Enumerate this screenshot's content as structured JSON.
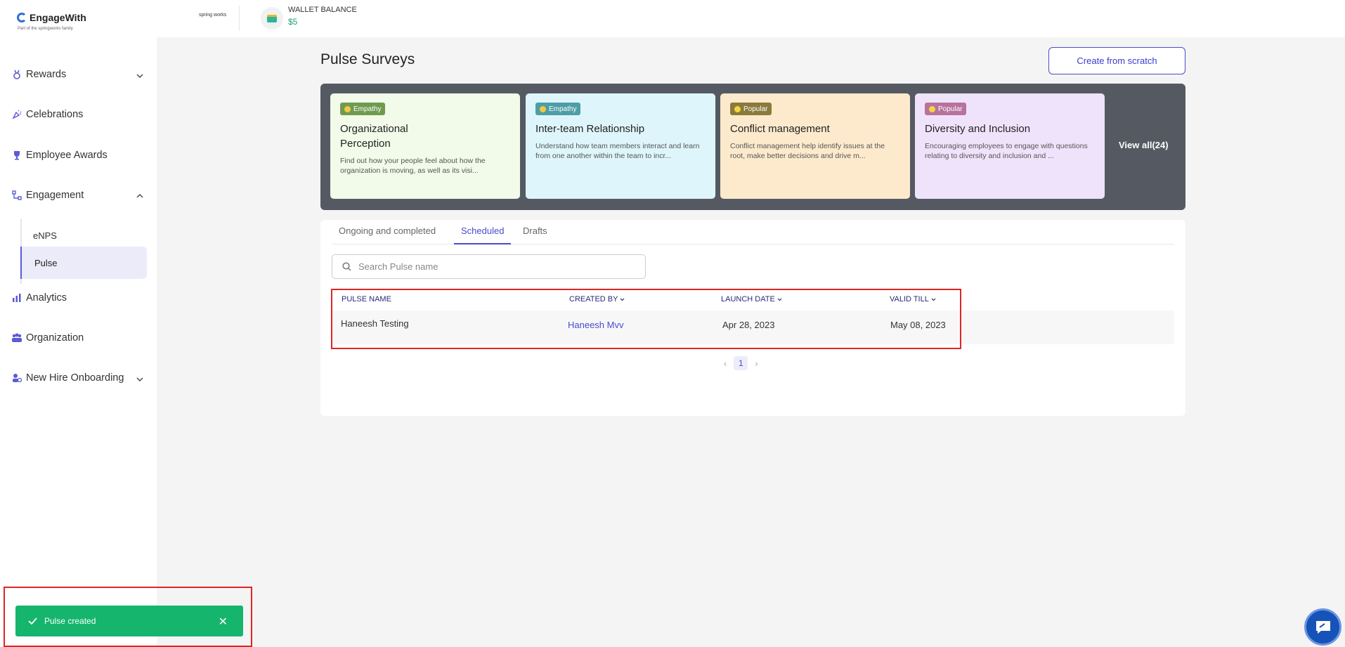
{
  "header": {
    "logo_text": "EngageWith",
    "logo_sub": "Part of the springworks family",
    "works_badge": "spring works",
    "wallet_label": "WALLET BALANCE",
    "wallet_value": "$5"
  },
  "sidebar": {
    "items": [
      {
        "label": "Rewards",
        "icon": "medal-icon"
      },
      {
        "label": "Celebrations",
        "icon": "confetti-icon"
      },
      {
        "label": "Employee Awards",
        "icon": "trophy-icon"
      },
      {
        "label": "Engagement",
        "icon": "flow-icon"
      },
      {
        "label": "Analytics",
        "icon": "bar-chart-icon"
      },
      {
        "label": "Organization",
        "icon": "people-icon"
      },
      {
        "label": "New Hire Onboarding",
        "icon": "user-gear-icon"
      }
    ],
    "subitems": [
      {
        "label": "eNPS"
      },
      {
        "label": "Pulse"
      }
    ]
  },
  "main": {
    "title": "Pulse Surveys",
    "create_label": "Create from scratch",
    "view_all": "View all(24)",
    "templates": [
      {
        "badge": "Empathy",
        "title": "Organizational Perception",
        "desc": "Find out how your people feel about how the organization is moving, as well as its visi...",
        "bg": "#f2fbe9",
        "badge_bg": "#6f9b50"
      },
      {
        "badge": "Empathy",
        "title": "Inter-team Relationship",
        "desc": "Understand how team members interact and learn from one another within the team to incr...",
        "bg": "#def6fb",
        "badge_bg": "#4d9ea6"
      },
      {
        "badge": "Popular",
        "title": "Conflict management",
        "desc": "Conflict management help identify issues at the root, make better decisions and drive m...",
        "bg": "#fdeacc",
        "badge_bg": "#8a7a3c"
      },
      {
        "badge": "Popular",
        "title": "Diversity and Inclusion",
        "desc": "Encouraging employees to engage with questions relating to diversity and inclusion and ...",
        "bg": "#efe3fb",
        "badge_bg": "#b7739e"
      }
    ],
    "tabs": [
      "Ongoing and completed",
      "Scheduled",
      "Drafts"
    ],
    "search_placeholder": "Search Pulse name",
    "table": {
      "headers": [
        "PULSE NAME",
        "CREATED BY",
        "LAUNCH DATE",
        "VALID TILL"
      ],
      "rows": [
        {
          "name": "Haneesh Testing",
          "created_by": "Haneesh Mvv",
          "launch": "Apr 28, 2023",
          "valid": "May 08, 2023"
        }
      ]
    },
    "page": "1"
  },
  "toast": {
    "message": "Pulse created"
  },
  "colors": {
    "accent": "#4a4ad0",
    "success": "#15b56d",
    "highlight": "#e02424"
  }
}
